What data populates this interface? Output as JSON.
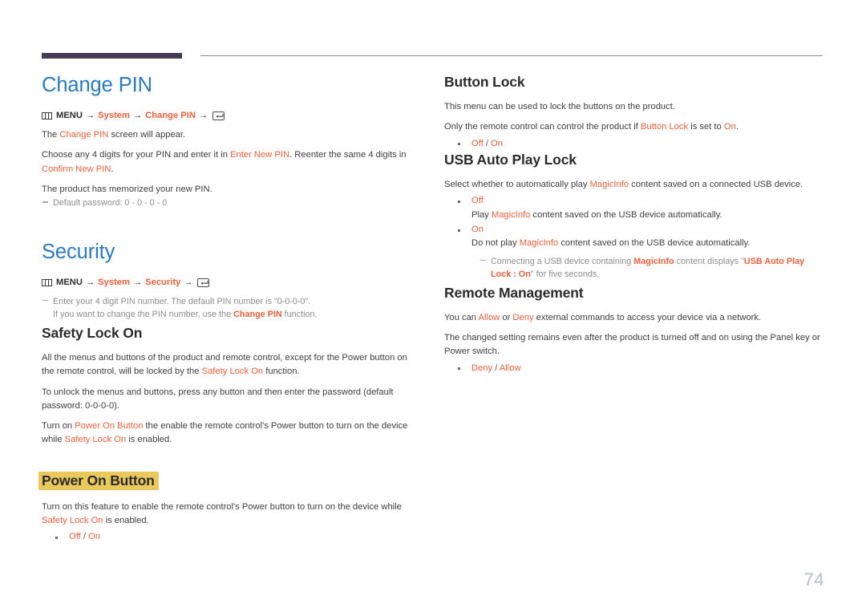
{
  "page": {
    "number": "74",
    "accent_purple": "#453a53",
    "accent_blue": "#2a7ac2",
    "accent_orange": "#e8603c",
    "highlight_yellow": "#e9c85c",
    "page_number_color": "#b7bfcb"
  },
  "left_column": {
    "change_pin": {
      "title": "Change PIN",
      "menu_path": {
        "menu_label": "MENU",
        "items": [
          "System",
          "Change PIN"
        ],
        "arrow": "→",
        "enter_icon": "enter-key-icon"
      },
      "lines": [
        {
          "parts": [
            {
              "t": "The ",
              "s": "n"
            },
            {
              "t": "Change PIN",
              "s": "o"
            },
            {
              "t": " screen will appear.",
              "s": "n"
            }
          ]
        },
        {
          "parts": [
            {
              "t": "Choose any 4 digits for your PIN and enter it in ",
              "s": "n"
            },
            {
              "t": "Enter New PIN",
              "s": "o"
            },
            {
              "t": ". Reenter the same 4 digits in ",
              "s": "n"
            },
            {
              "t": "Confirm New PIN",
              "s": "o"
            },
            {
              "t": ".",
              "s": "n"
            }
          ]
        },
        {
          "parts": [
            {
              "t": "The product has memorized your new PIN.",
              "s": "n"
            }
          ]
        }
      ],
      "note": "Default password: 0 - 0 - 0 - 0"
    },
    "security": {
      "title": "Security",
      "menu_path": {
        "menu_label": "MENU",
        "items": [
          "System",
          "Security"
        ],
        "arrow": "→",
        "enter_icon": "enter-key-icon"
      },
      "note_line1": "Enter your 4 digit PIN number. The default PIN number is \"0-0-0-0\".",
      "note_line2_parts": [
        {
          "t": "If you want to change the PIN number, use the ",
          "s": "g"
        },
        {
          "t": "Change PIN",
          "s": "ob"
        },
        {
          "t": " function.",
          "s": "g"
        }
      ]
    },
    "safety_lock_on": {
      "title": "Safety Lock On",
      "lines": [
        {
          "parts": [
            {
              "t": "All the menus and buttons of the product and remote control, except for the Power button on the remote control, will be locked by the ",
              "s": "n"
            },
            {
              "t": "Safety Lock On",
              "s": "o"
            },
            {
              "t": " function.",
              "s": "n"
            }
          ]
        },
        {
          "parts": [
            {
              "t": "To unlock the menus and buttons, press any button and then enter the password (default password: 0-0-0-0).",
              "s": "n"
            }
          ]
        },
        {
          "parts": [
            {
              "t": "Turn on ",
              "s": "n"
            },
            {
              "t": "Power On Button",
              "s": "o"
            },
            {
              "t": " the enable the remote control's Power button to turn on the device while ",
              "s": "n"
            },
            {
              "t": "Safety Lock On",
              "s": "o"
            },
            {
              "t": " is enabled.",
              "s": "n"
            }
          ]
        }
      ]
    },
    "power_on_button": {
      "title": "Power On Button",
      "highlighted": true,
      "lines": [
        {
          "parts": [
            {
              "t": "Turn on this feature to enable the remote control's Power button to turn on the device while ",
              "s": "n"
            },
            {
              "t": "Safety Lock On",
              "s": "o"
            },
            {
              "t": " is enabled.",
              "s": "n"
            }
          ]
        }
      ],
      "options": [
        {
          "value": "Off",
          "sep": " / ",
          "value2": "On"
        }
      ]
    }
  },
  "right_column": {
    "button_lock": {
      "title": "Button Lock",
      "lines": [
        {
          "parts": [
            {
              "t": "This menu can be used to lock the buttons on the product.",
              "s": "n"
            }
          ]
        },
        {
          "parts": [
            {
              "t": "Only the remote control can control the product if ",
              "s": "n"
            },
            {
              "t": "Button Lock",
              "s": "o"
            },
            {
              "t": " is set to ",
              "s": "n"
            },
            {
              "t": "On",
              "s": "o"
            },
            {
              "t": ".",
              "s": "n"
            }
          ]
        }
      ],
      "options": [
        {
          "value": "Off",
          "sep": " / ",
          "value2": "On"
        }
      ]
    },
    "usb_auto_play_lock": {
      "title": "USB Auto Play Lock",
      "lines": [
        {
          "parts": [
            {
              "t": "Select whether to automatically play ",
              "s": "n"
            },
            {
              "t": "MagicInfo",
              "s": "o"
            },
            {
              "t": " content saved on a connected USB device.",
              "s": "n"
            }
          ]
        }
      ],
      "bullets": [
        {
          "label": "Off",
          "desc_parts": [
            {
              "t": "Play ",
              "s": "n"
            },
            {
              "t": "MagicInfo",
              "s": "o"
            },
            {
              "t": " content saved on the USB device automatically.",
              "s": "n"
            }
          ]
        },
        {
          "label": "On",
          "desc_parts": [
            {
              "t": "Do not play ",
              "s": "n"
            },
            {
              "t": "MagicInfo",
              "s": "o"
            },
            {
              "t": " content saved on the USB device automatically.",
              "s": "n"
            }
          ]
        }
      ],
      "note_parts": [
        {
          "t": "Connecting a USB device containing ",
          "s": "g"
        },
        {
          "t": "MagicInfo",
          "s": "ob"
        },
        {
          "t": " content displays \"",
          "s": "g"
        },
        {
          "t": "USB Auto Play Lock : On",
          "s": "ob"
        },
        {
          "t": "\" for five seconds.",
          "s": "g"
        }
      ]
    },
    "remote_management": {
      "title": "Remote Management",
      "lines": [
        {
          "parts": [
            {
              "t": "You can ",
              "s": "n"
            },
            {
              "t": "Allow",
              "s": "o"
            },
            {
              "t": " or ",
              "s": "n"
            },
            {
              "t": "Deny",
              "s": "o"
            },
            {
              "t": " external commands to access your device via a network.",
              "s": "n"
            }
          ]
        },
        {
          "parts": [
            {
              "t": "The changed setting remains even after the product is turned off and on using the Panel key or Power switch.",
              "s": "n"
            }
          ]
        }
      ],
      "options": [
        {
          "value": "Deny",
          "sep": " / ",
          "value2": "Allow"
        }
      ]
    }
  }
}
